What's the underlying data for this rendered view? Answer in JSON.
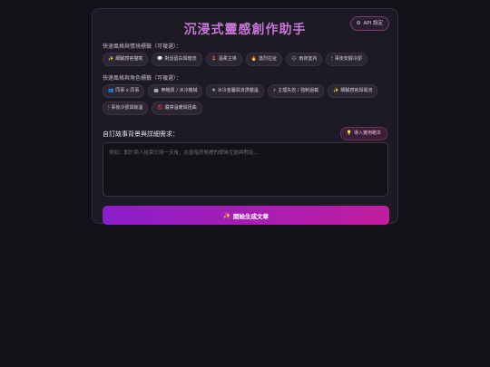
{
  "header": {
    "title": "沉浸式靈感創作助手",
    "api_settings": {
      "icon": "gear-icon",
      "label": "API 設定"
    }
  },
  "style_section": {
    "label": "快速風格與情境標籤（可複選）：",
    "tags": [
      {
        "icon": "sparkles-icon",
        "glyph": "✨",
        "label": "細膩感官描寫"
      },
      {
        "icon": "speech-bubble-icon",
        "glyph": "💬",
        "label": "對話留白與暗流"
      },
      {
        "icon": "lipstick-icon",
        "glyph": "💄",
        "label": "溫柔主導"
      },
      {
        "icon": "fire-icon",
        "glyph": "🔥",
        "label": "激烈拉扯"
      },
      {
        "icon": "rain-cloud-icon",
        "glyph": "🌧",
        "label": "雨夜室內"
      },
      {
        "icon": "candle-icon",
        "glyph": "🕯",
        "label": "事後安靜冷卻"
      }
    ]
  },
  "role_section": {
    "label": "快速風格與角色標籤（可複選）：",
    "tags": [
      {
        "icon": "users-icon",
        "glyph": "👥",
        "label": "同事 x 同事"
      },
      {
        "icon": "robot-icon",
        "glyph": "🤖",
        "label": "無機質 / 冰冷機械"
      },
      {
        "icon": "snowflake-icon",
        "glyph": "❄",
        "label": "冰冷金屬與滾燙體溫"
      },
      {
        "icon": "lightning-icon",
        "glyph": "⚡",
        "label": "主理失控 / 強制過載"
      },
      {
        "icon": "sparkles-icon",
        "glyph": "✨",
        "label": "細膩感官與電流"
      },
      {
        "icon": "candle-icon",
        "glyph": "🕯",
        "label": "事後冷卻與餘溫"
      },
      {
        "icon": "forbidden-icon",
        "glyph": "🚫",
        "label": "嚴禁溫暖與扭曲"
      }
    ]
  },
  "story": {
    "label": "自訂故事背景與詳細需求：",
    "import_button": {
      "icon": "lightbulb-icon",
      "glyph": "💡",
      "label": "導入實用範本"
    },
    "placeholder": "例如：關於兩人結束忙碌一天後，在昏暗房間裡的曖昧互動與對話..."
  },
  "generate": {
    "icon": "sparkles-icon",
    "glyph": "✨",
    "label": "開始生成文章"
  },
  "colors": {
    "background": "#141218",
    "card": "#1e1a25",
    "accent_start": "#8a1fc8",
    "accent_end": "#c11e9e",
    "title": "#c678d8"
  }
}
